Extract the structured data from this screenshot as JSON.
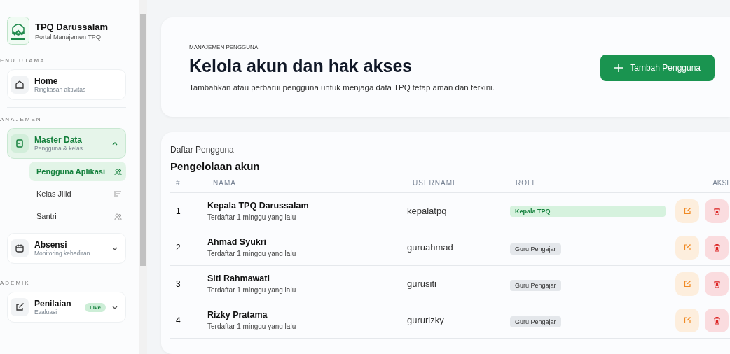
{
  "brand": {
    "name": "TPQ Darussalam",
    "subtitle": "Portal Manajemen TPQ"
  },
  "sidebar": {
    "sections": [
      {
        "label": "ENU UTAMA",
        "items": [
          {
            "kind": "home",
            "title": "Home",
            "subtitle": "Ringkasan aktivitas",
            "selected": false
          }
        ]
      },
      {
        "label": "ANAJEMEN",
        "items": [
          {
            "kind": "data",
            "title": "Master Data",
            "subtitle": "Pengguna & kelas",
            "selected": true,
            "expanded": true,
            "children": [
              {
                "label": "Pengguna Aplikasi",
                "kind": "users",
                "selected": true
              },
              {
                "label": "Kelas Jilid",
                "kind": "list",
                "selected": false
              },
              {
                "label": "Santri",
                "kind": "users",
                "selected": false
              }
            ]
          },
          {
            "kind": "calendar",
            "title": "Absensi",
            "subtitle": "Monitoring kehadiran",
            "selected": false,
            "expanded": false
          }
        ]
      },
      {
        "label": "ADEMIK",
        "items": [
          {
            "kind": "edit",
            "title": "Penilaian",
            "subtitle": "Evaluasi",
            "badge": "Live",
            "selected": false,
            "expanded": false
          }
        ]
      }
    ]
  },
  "header": {
    "eyebrow": "MANAJEMEN PENGGUNA",
    "title": "Kelola akun dan hak akses",
    "description": "Tambahkan atau perbarui pengguna untuk menjaga data TPQ tetap aman dan terkini.",
    "button": "Tambah Pengguna"
  },
  "table": {
    "eyebrow": "Daftar Pengguna",
    "title": "Pengelolaan akun",
    "columns": [
      "#",
      "NAMA",
      "USERNAME",
      "ROLE",
      "AKSI"
    ],
    "rows": [
      {
        "no": "1",
        "name": "Kepala TPQ Darussalam",
        "registered": "Terdaftar 1 minggu yang lalu",
        "username": "kepalatpq",
        "role": {
          "label": "Kepala TPQ",
          "kind": "head"
        }
      },
      {
        "no": "2",
        "name": "Ahmad Syukri",
        "registered": "Terdaftar 1 minggu yang lalu",
        "username": "guruahmad",
        "role": {
          "label": "Guru Pengajar",
          "kind": "teacher"
        }
      },
      {
        "no": "3",
        "name": "Siti Rahmawati",
        "registered": "Terdaftar 1 minggu yang lalu",
        "username": "gurusiti",
        "role": {
          "label": "Guru Pengajar",
          "kind": "teacher"
        }
      },
      {
        "no": "4",
        "name": "Rizky Pratama",
        "registered": "Terdaftar 1 minggu yang lalu",
        "username": "gururizky",
        "role": {
          "label": "Guru Pengajar",
          "kind": "teacher"
        }
      }
    ]
  }
}
